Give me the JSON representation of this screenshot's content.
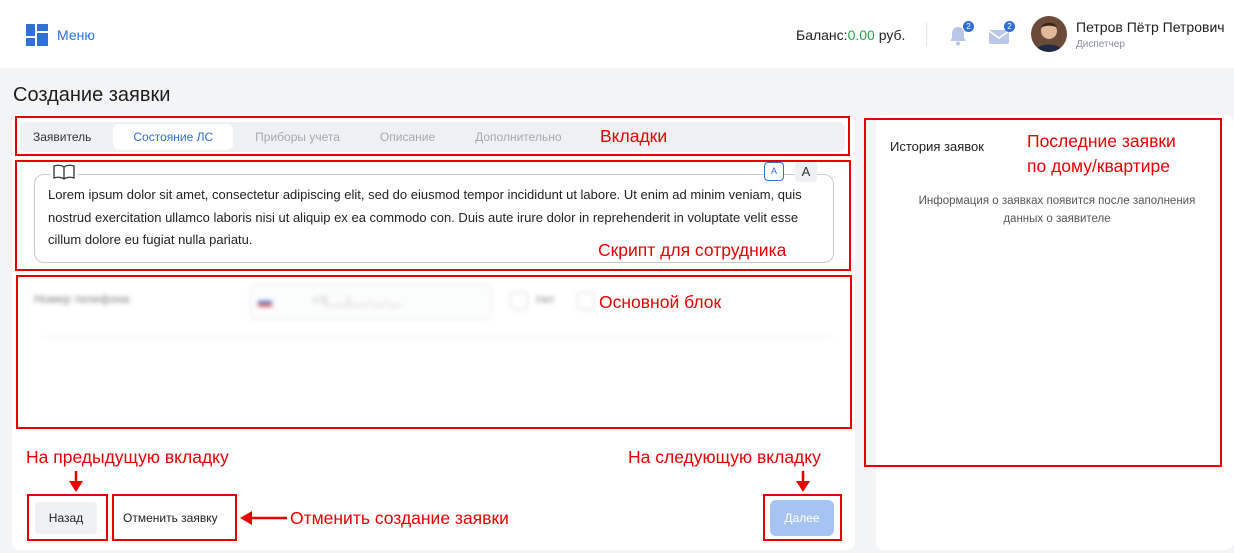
{
  "header": {
    "menu_label": "Меню",
    "balance_label": "Баланс:",
    "balance_amount": "0.00",
    "balance_currency": " руб.",
    "notifications_count": "2",
    "messages_count": "2",
    "user_name": "Петров Пётр Петрович",
    "user_role": "Диспетчер"
  },
  "page": {
    "title": "Создание заявки"
  },
  "tabs": [
    {
      "label": "Заявитель"
    },
    {
      "label": "Состояние ЛС"
    },
    {
      "label": "Приборы учета"
    },
    {
      "label": "Описание"
    },
    {
      "label": "Дополнительно"
    }
  ],
  "active_tab": "Состояние ЛС",
  "script": {
    "text": "Lorem ipsum dolor sit amet, consectetur adipiscing elit, sed do eiusmod tempor incididunt ut labore. Ut enim ad minim veniam, quis nostrud exercitation ullamco laboris nisi ut aliquip ex ea commodo con. Duis aute irure dolor in reprehenderit in voluptate velit esse cillum dolore eu fugiat nulla pariatu.",
    "font_small_label": "A",
    "font_large_label": "A"
  },
  "actions": {
    "back_label": "Назад",
    "cancel_label": "Отменить заявку",
    "next_label": "Далее"
  },
  "history": {
    "title": "История заявок",
    "empty_text": "Информация о заявках появится после заполнения данных о заявителе"
  },
  "annotations": {
    "tabs": "Вкладки",
    "script": "Скрипт для сотрудника",
    "main_block": "Основной блок",
    "history_line1": "Последние заявки",
    "history_line2": "по дому/квартире",
    "prev_tab": "На предыдущую вкладку",
    "next_tab": "На следующую вкладку",
    "cancel": "Отменить создание заявки"
  },
  "colors": {
    "accent": "#2f6fd6",
    "balance_green": "#1fa84a",
    "annotation_red": "#e60000",
    "next_button_disabled": "#a6c3f2"
  }
}
